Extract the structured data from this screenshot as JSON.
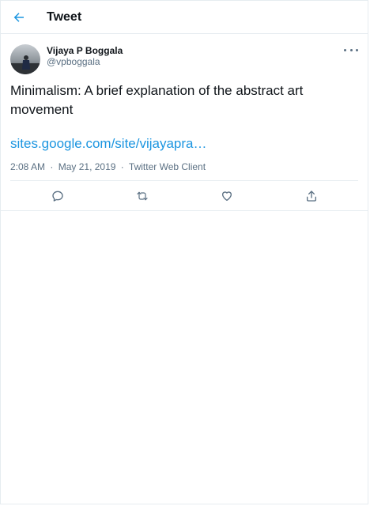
{
  "header": {
    "title": "Tweet",
    "back_icon": "arrow-left-icon"
  },
  "tweet": {
    "author": {
      "display_name": "Vijaya P Boggala",
      "handle": "@vpboggala",
      "avatar": "profile-photo"
    },
    "text": "Minimalism: A brief explanation of the abstract art movement",
    "link": "sites.google.com/site/vijayapra…",
    "meta": {
      "time": "2:08 AM",
      "date": "May 21, 2019",
      "source": "Twitter Web Client",
      "separator": "·"
    },
    "actions": [
      {
        "name": "reply",
        "icon": "reply-icon"
      },
      {
        "name": "retweet",
        "icon": "retweet-icon"
      },
      {
        "name": "like",
        "icon": "heart-icon"
      },
      {
        "name": "share",
        "icon": "share-icon"
      }
    ]
  },
  "colors": {
    "accent": "#1b95e0",
    "text": "#0f1419",
    "secondary": "#5b7083",
    "border": "#e6ecf0"
  }
}
